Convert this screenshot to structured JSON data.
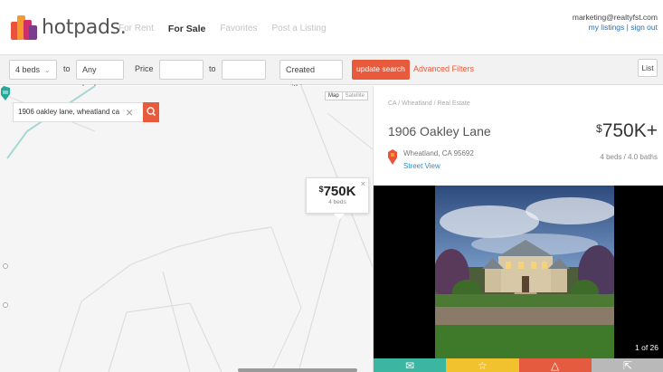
{
  "header": {
    "logo_text": "hotpads.",
    "nav": [
      "For Rent",
      "For Sale",
      "Favorites",
      "Post a Listing"
    ],
    "active_nav": "For Sale",
    "account_email": "marketing@realtyfst.com",
    "account_links": "my listings | sign out"
  },
  "filters": {
    "beds_min": "4 beds",
    "to_1": "to",
    "beds_max": "Any beds",
    "price_label": "Price",
    "price_min": "",
    "to_2": "to",
    "price_max": "",
    "created_within": "Created within",
    "update_label": "update search",
    "advanced_label": "Advanced Filters",
    "list_label": "List"
  },
  "map": {
    "search_value": "1906 oakley lane, wheatland ca",
    "toggle_map": "Map",
    "toggle_satellite": "Satellite",
    "popup_currency": "$",
    "popup_price": "750K",
    "popup_beds": "4 beds"
  },
  "listing": {
    "breadcrumb": "CA / Wheatland / Real Estate",
    "address": "1906 Oakley Lane",
    "currency": "$",
    "price": "750K+",
    "beds_baths": "4 beds / 4.0 baths",
    "city": "Wheatland, CA 95692",
    "street_view": "Street View",
    "photo_count": "1 of 26"
  },
  "colors": {
    "accent": "#e85a3c",
    "link": "#2d6fb0",
    "mail": "#3cb6a0",
    "star": "#f2c12e",
    "warn": "#e45b3f",
    "share": "#b9b9b9"
  },
  "icons": {
    "search": "search-icon",
    "clear": "close-icon",
    "pin": "map-pin-icon",
    "mail": "mail-icon",
    "favorite": "star-icon",
    "report": "warning-icon",
    "share": "share-icon"
  }
}
